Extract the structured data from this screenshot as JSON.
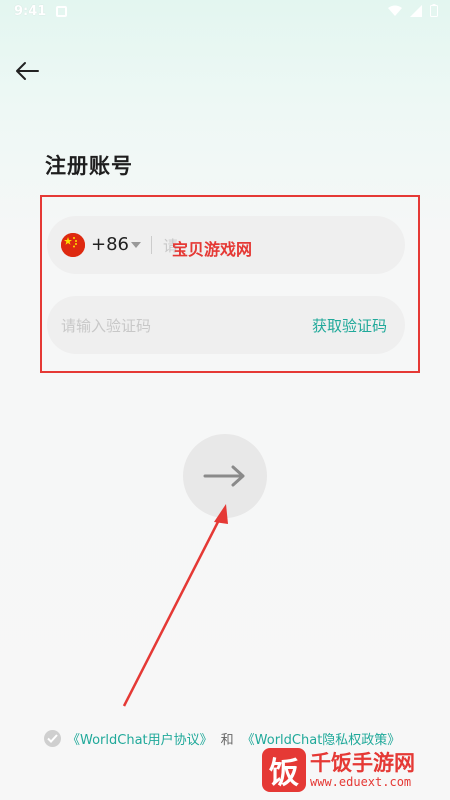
{
  "status_bar": {
    "time": "9:41"
  },
  "page": {
    "title": "注册账号"
  },
  "phone": {
    "country_code": "+86",
    "placeholder": "请"
  },
  "verification": {
    "placeholder": "请输入验证码",
    "get_code_label": "获取验证码"
  },
  "watermark": {
    "overlay_text": "宝贝游戏网",
    "logo_mark": "饭",
    "logo_name": "千饭手游网",
    "logo_url": "www.eduext.com"
  },
  "agreement": {
    "user_agreement": "《WorldChat用户协议》",
    "and": "和",
    "privacy_policy": "《WorldChat隐私权政策》"
  },
  "colors": {
    "accent": "#20a99a",
    "annotation": "#e53935"
  }
}
